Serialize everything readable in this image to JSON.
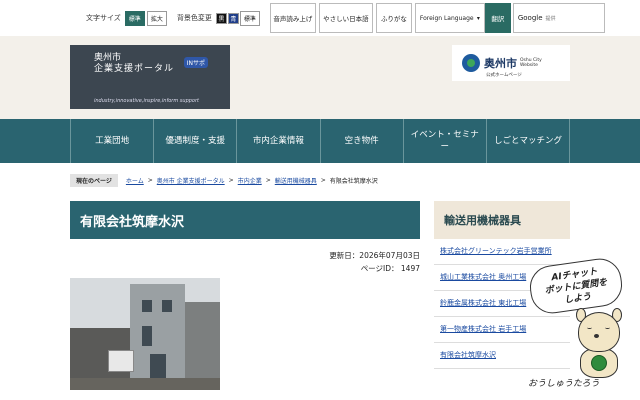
{
  "utility": {
    "font_size_label": "文字サイズ",
    "font_standard": "標準",
    "font_large": "拡大",
    "bg_label": "背景色変更",
    "bg_black": "黒",
    "bg_blue": "青",
    "bg_standard": "標準",
    "read_aloud": "音声読み上げ",
    "easy_japanese": "やさしい日本語",
    "furigana": "ふりがな",
    "foreign_language": "Foreign Language",
    "translate": "翻訳",
    "google_label": "Google",
    "google_sub": "提供"
  },
  "header": {
    "portal_line1": "奥州市",
    "portal_line2": "企業支援ポータル",
    "portal_badge": "INサポ",
    "portal_tagline": "industry,innovative,inspire,inform support",
    "city_name": "奥州市",
    "city_en_1": "Oshu City",
    "city_en_2": "Website",
    "city_small": "公式ホームページ"
  },
  "nav": {
    "items": [
      "工業団地",
      "優遇制度・支援",
      "市内企業情報",
      "空き物件",
      "イベント・セミナー",
      "しごとマッチング"
    ]
  },
  "breadcrumb": {
    "current_label": "現在のページ",
    "items": [
      "ホーム",
      "奥州市 企業支援ポータル",
      "市内企業",
      "輸送用機械器具",
      "有限会社筑摩水沢"
    ]
  },
  "page": {
    "title": "有限会社筑摩水沢",
    "updated": "更新日：2026年07月03日",
    "page_id": "ページID： 1497"
  },
  "sidebar": {
    "heading": "輸送用機械器具",
    "items": [
      "株式会社グリーンテック岩手営業所",
      "城山工業株式会社 奥州工場",
      "鈴鹿金属株式会社 東北工場",
      "第一物産株式会社 岩手工場",
      "有限会社筑摩水沢"
    ]
  },
  "chatbot": {
    "line1": "AIチャット",
    "line2": "ボットに質問を",
    "line3": "しよう",
    "name": "おうしゅうたろう"
  }
}
